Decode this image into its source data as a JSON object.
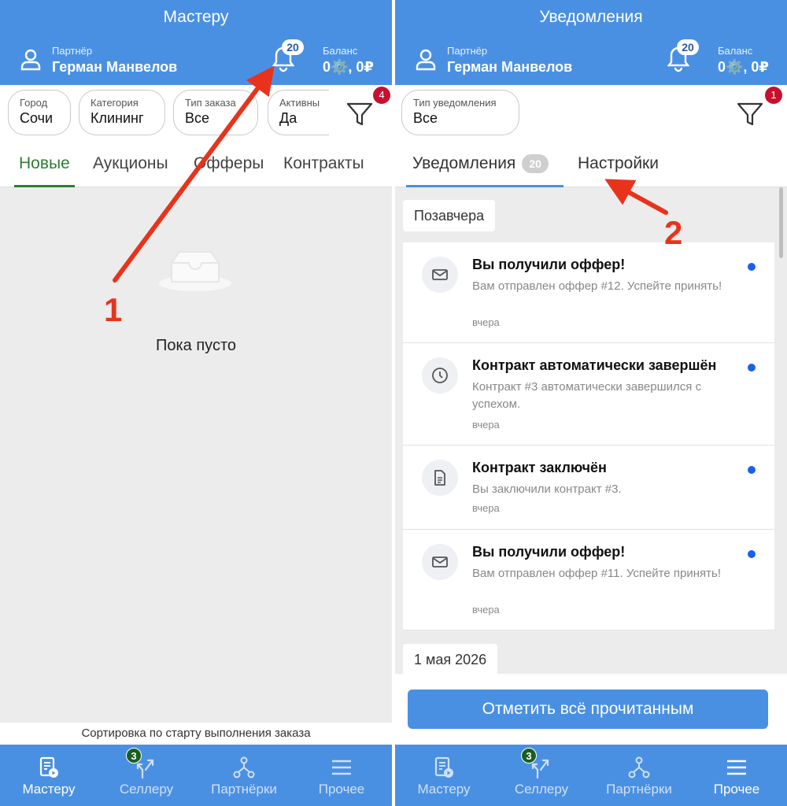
{
  "left": {
    "title": "Мастеру",
    "partner_label": "Партнёр",
    "partner_name": "Герман Манвелов",
    "bell_count": "20",
    "balance_label": "Баланс",
    "balance_value": "0⚙️, 0₽",
    "filters": [
      {
        "label": "Город",
        "value": "Сочи"
      },
      {
        "label": "Категория",
        "value": "Клининг"
      },
      {
        "label": "Тип заказа",
        "value": "Все"
      },
      {
        "label": "Активны",
        "value": "Да"
      }
    ],
    "filter_badge": "4",
    "tabs": [
      "Новые",
      "Аукционы",
      "Офферы",
      "Контракты"
    ],
    "empty_text": "Пока пусто",
    "sort_text": "Сортировка по старту выполнения заказа"
  },
  "right": {
    "title": "Уведомления",
    "partner_label": "Партнёр",
    "partner_name": "Герман Манвелов",
    "bell_count": "20",
    "balance_label": "Баланс",
    "balance_value": "0⚙️, 0₽",
    "filter": {
      "label": "Тип уведомления",
      "value": "Все"
    },
    "filter_badge": "1",
    "tabs": {
      "notifications": "Уведомления",
      "notifications_count": "20",
      "settings": "Настройки"
    },
    "group_1_date": "Позавчера",
    "notifications": [
      {
        "icon": "mail-icon",
        "title": "Вы получили оффер!",
        "body": "Вам отправлен оффер #12. Успейте принять!",
        "time": "вчера"
      },
      {
        "icon": "clock-icon",
        "title": "Контракт автоматически завершён",
        "body": "Контракт #3 автоматически завершился с успехом.",
        "time": "вчера"
      },
      {
        "icon": "document-icon",
        "title": "Контракт заключён",
        "body": "Вы заключили контракт #3.",
        "time": "вчера"
      },
      {
        "icon": "mail-icon",
        "title": "Вы получили оффер!",
        "body": "Вам отправлен оффер #11. Успейте принять!",
        "time": "вчера"
      }
    ],
    "group_2_date": "1 мая 2026",
    "mark_all_button": "Отметить всё прочитанным"
  },
  "bottom_nav": {
    "items": [
      {
        "label": "Мастеру",
        "icon": "master-icon"
      },
      {
        "label": "Селлеру",
        "icon": "seller-icon",
        "badge": "3"
      },
      {
        "label": "Партнёрки",
        "icon": "partners-icon"
      },
      {
        "label": "Прочее",
        "icon": "menu-icon"
      }
    ]
  },
  "annotations": {
    "one": "1",
    "two": "2"
  },
  "colors": {
    "primary": "#4a90e2",
    "active_tab_green": "#2e7d32",
    "badge_red": "#c8102e",
    "unread_dot": "#1a5ff0",
    "arrow_red": "#e8331c"
  }
}
